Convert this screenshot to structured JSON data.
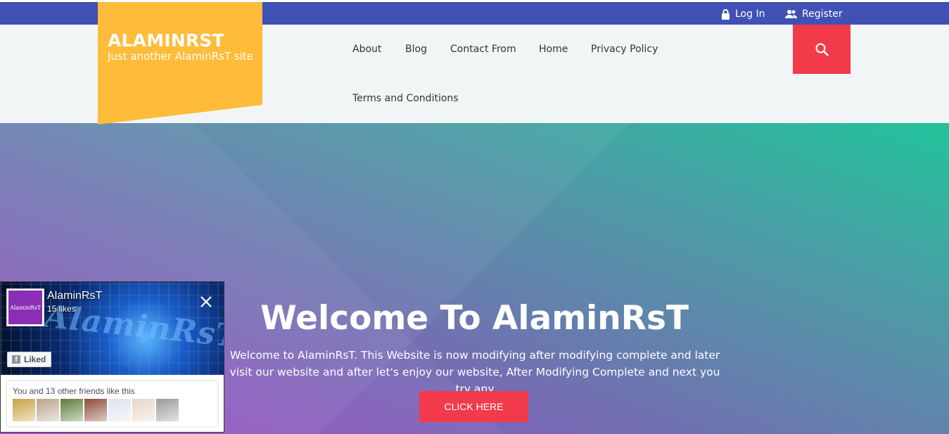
{
  "topbar": {
    "login_label": "Log In",
    "register_label": "Register",
    "bg_color": "#3f51b5"
  },
  "site": {
    "title": "ALAMINRST",
    "tagline": "Just another AlaminRsT site",
    "logo_color": "#ffbb3a"
  },
  "nav": {
    "items": [
      {
        "label": "About"
      },
      {
        "label": "Blog"
      },
      {
        "label": "Contact From"
      },
      {
        "label": "Home"
      },
      {
        "label": "Privacy Policy"
      },
      {
        "label": "Terms and Conditions"
      }
    ],
    "search_icon": "search-icon",
    "accent_color": "#f23a4b"
  },
  "hero": {
    "title": "Welcome To AlaminRsT",
    "text": "Welcome to AlaminRsT. This Website is now modifying after modifying complete and later visit our website and after let's enjoy our website, After Modifying Complete and next you try any",
    "cta_label": "CLICK HERE"
  },
  "fb_widget": {
    "page_name": "AlaminRsT",
    "likes": "15 likes",
    "avatar_text": "AlaminRsT",
    "cover_text": "AlaminRsT",
    "liked_label": "Liked",
    "friends_text": "You and 13 other friends like this",
    "friend_faces": [
      {
        "color": "#c9a040"
      },
      {
        "color": "#b9a38c"
      },
      {
        "color": "#5c7a3a"
      },
      {
        "color": "#8c4a3a"
      },
      {
        "color": "#dfe3ee"
      },
      {
        "color": "#e8d6c8"
      },
      {
        "color": "#9a9a9a"
      }
    ]
  }
}
